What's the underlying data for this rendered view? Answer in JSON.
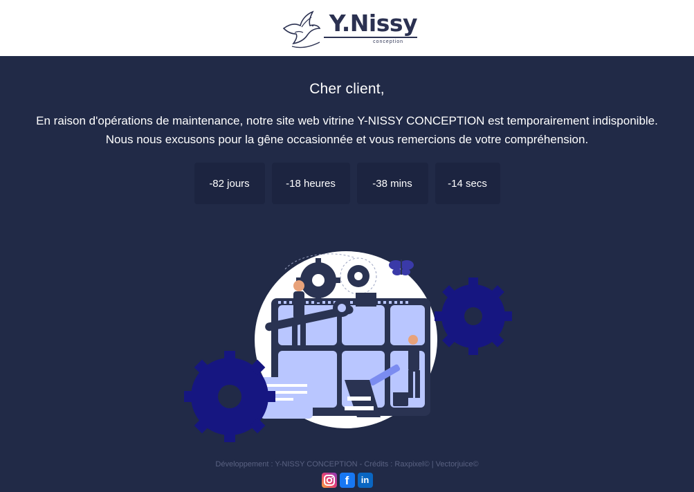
{
  "brand": {
    "name": "Y.Nissy",
    "tagline": "conception"
  },
  "notice": {
    "greeting": "Cher client,",
    "line1": "En raison d'opérations de maintenance, notre site web vitrine Y-NISSY CONCEPTION est temporairement indisponible.",
    "line2": "Nous nous excusons pour la gêne occasionnée et vous remercions de votre compréhension."
  },
  "countdown": {
    "days": "-82 jours",
    "hours": "-18 heures",
    "mins": "-38 mins",
    "secs": "-14 secs"
  },
  "footer": {
    "credits": "Développement : Y-NISSY CONCEPTION - Crédits : Raxpixel© | Vectorjuice©",
    "social": [
      "instagram-icon",
      "facebook-icon",
      "linkedin-icon"
    ]
  },
  "colors": {
    "background": "#212a47",
    "box": "#1c2440",
    "gear": "#161681",
    "accent": "#b9c6ff"
  }
}
